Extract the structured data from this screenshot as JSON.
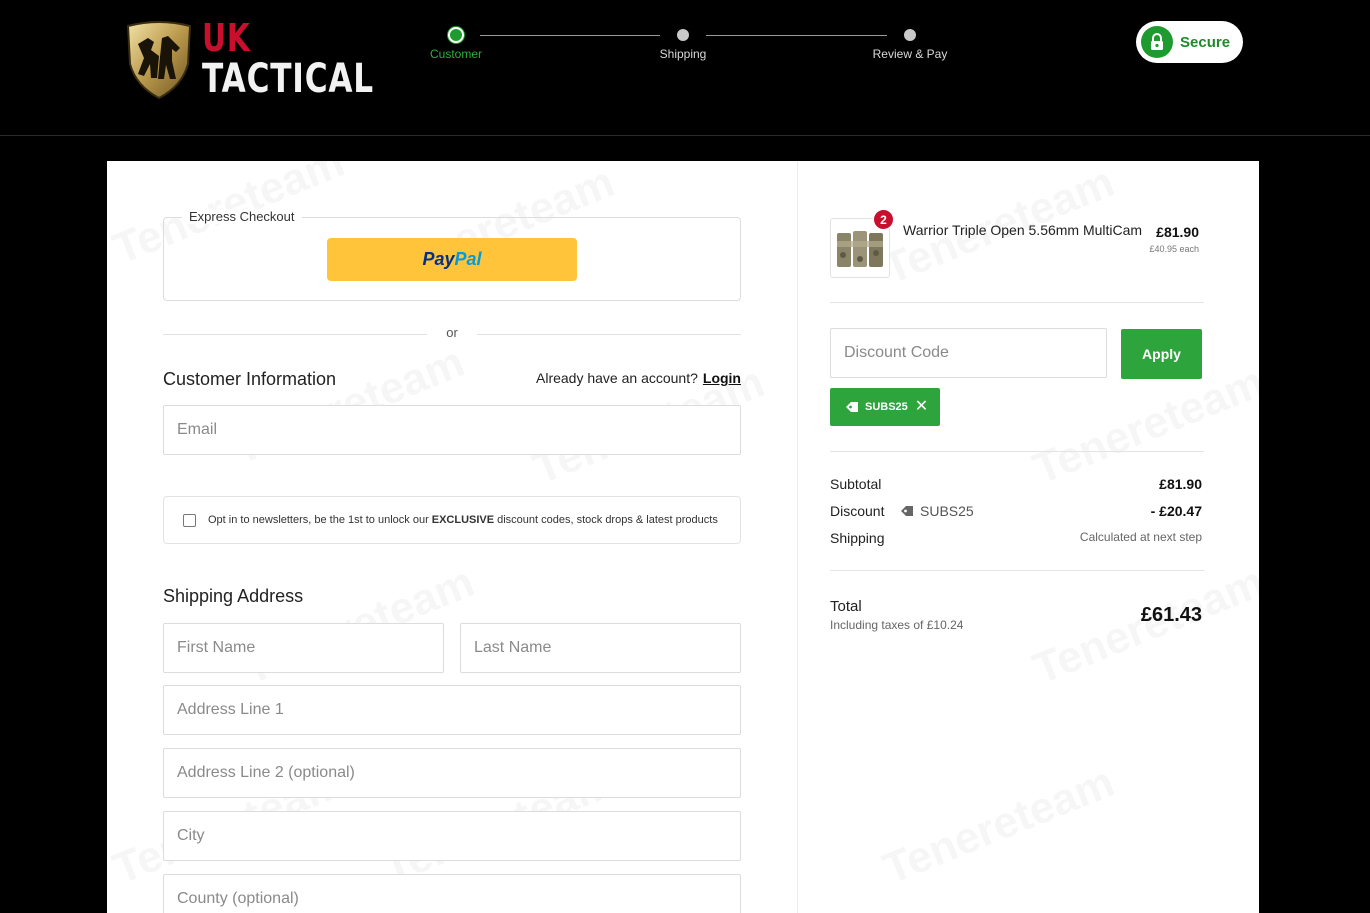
{
  "header": {
    "logo_top": "UK",
    "logo_bottom": "TACTICAL",
    "steps": [
      {
        "label": "Customer",
        "active": true
      },
      {
        "label": "Shipping",
        "active": false
      },
      {
        "label": "Review & Pay",
        "active": false
      }
    ],
    "secure_label": "Secure"
  },
  "watermark_text": "Tenereteam",
  "express": {
    "legend": "Express Checkout",
    "paypal_a": "Pay",
    "paypal_b": "Pal",
    "or_label": "or"
  },
  "customer": {
    "title": "Customer Information",
    "account_prompt": "Already have an account?",
    "login_label": "Login",
    "email_placeholder": "Email",
    "newsletter_pre": "Opt in to newsletters, be the 1st to unlock our",
    "newsletter_bold": "EXCLUSIVE",
    "newsletter_post": "discount codes, stock drops & latest products"
  },
  "shipping": {
    "title": "Shipping Address",
    "first_name": "First Name",
    "last_name": "Last Name",
    "address1": "Address Line 1",
    "address2": "Address Line 2 (optional)",
    "city": "City",
    "county": "County (optional)"
  },
  "order": {
    "item_name": "Warrior Triple Open 5.56mm MultiCam",
    "item_qty": "2",
    "item_price": "£81.90",
    "item_each": "£40.95 each",
    "discount_placeholder": "Discount Code",
    "apply_label": "Apply",
    "applied_code": "SUBS25",
    "subtotal_label": "Subtotal",
    "subtotal_value": "£81.90",
    "discount_label": "Discount",
    "discount_code": "SUBS25",
    "discount_value": "- £20.47",
    "shipping_label": "Shipping",
    "shipping_value": "Calculated at next step",
    "total_label": "Total",
    "total_sub": "Including taxes of £10.24",
    "total_value": "£61.43"
  },
  "colors": {
    "brand_green": "#2ea53c",
    "brand_red": "#c8102e",
    "paypal_yellow": "#ffc439"
  }
}
